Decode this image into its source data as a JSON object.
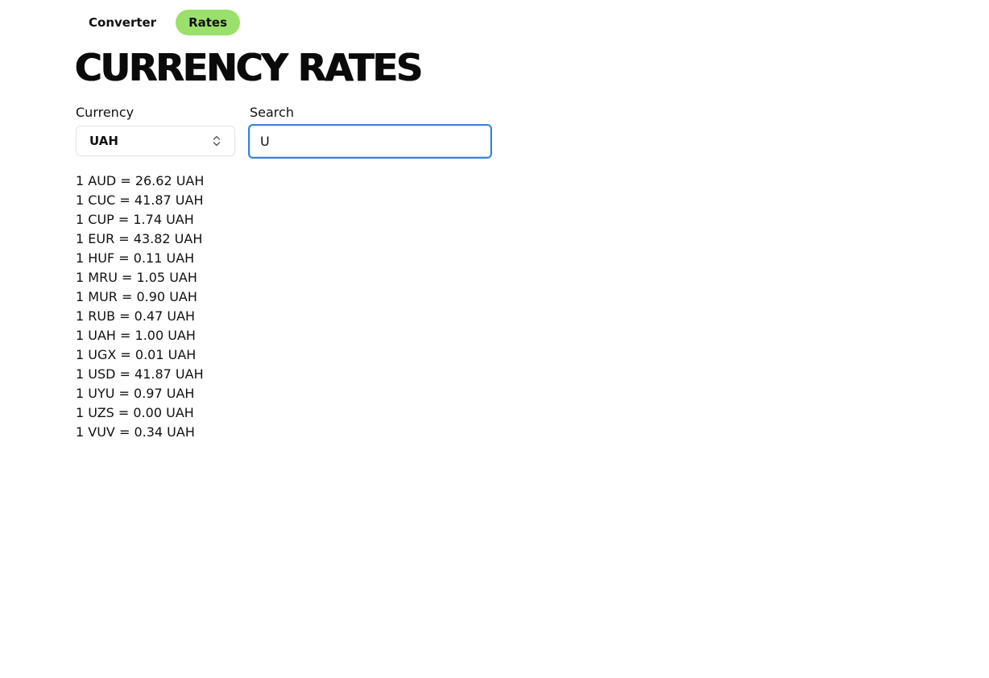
{
  "nav": {
    "tabs": [
      {
        "label": "Converter",
        "active": false
      },
      {
        "label": "Rates",
        "active": true
      }
    ]
  },
  "colors": {
    "accent": "#9be06a",
    "focus_border": "#3f82d8"
  },
  "header": {
    "title": "CURRENCY RATES"
  },
  "controls": {
    "currency_label": "Currency",
    "currency_value": "UAH",
    "search_label": "Search",
    "search_value": "U"
  },
  "icons": {
    "select_chevron": "chevron-up-down-icon"
  },
  "rates": [
    "1 AUD = 26.62 UAH",
    "1 CUC = 41.87 UAH",
    "1 CUP = 1.74 UAH",
    "1 EUR = 43.82 UAH",
    "1 HUF = 0.11 UAH",
    "1 MRU = 1.05 UAH",
    "1 MUR = 0.90 UAH",
    "1 RUB = 0.47 UAH",
    "1 UAH = 1.00 UAH",
    "1 UGX = 0.01 UAH",
    "1 USD = 41.87 UAH",
    "1 UYU = 0.97 UAH",
    "1 UZS = 0.00 UAH",
    "1 VUV = 0.34 UAH"
  ]
}
